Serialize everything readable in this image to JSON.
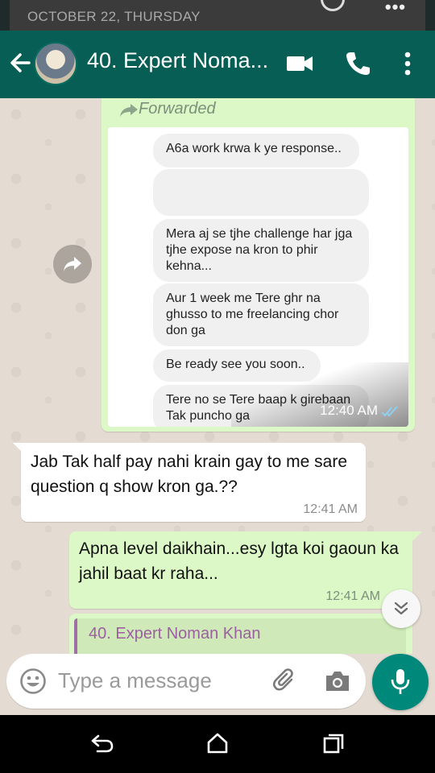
{
  "notification": {
    "date_text": "OCTOBER 22, THURSDAY"
  },
  "header": {
    "contact_name": "40. Expert Noma..."
  },
  "forwarded_message": {
    "label": "Forwarded",
    "time": "12:40 AM",
    "screenshot_bubbles": [
      "A6a work krwa k ye response..",
      "",
      "Mera aj se tjhe challenge har jga tjhe expose na kron to phir kehna...",
      "Aur 1 week me Tere ghr na ghusso to me freelancing chor don ga",
      "Be ready see you soon..",
      "Tere no se Tere baap k girebaan Tak puncho ga"
    ]
  },
  "messages": [
    {
      "direction": "incoming",
      "text": "Jab Tak half pay nahi krain gay to me sare question q show kron ga.??",
      "time": "12:41 AM"
    },
    {
      "direction": "outgoing",
      "text": "Apna level daikhain...esy lgta koi gaoun ka jahil baat kr raha...",
      "time": "12:41 AM"
    }
  ],
  "reply_quote": {
    "name": "40. Expert Noman Khan"
  },
  "composer": {
    "placeholder": "Type a message"
  },
  "colors": {
    "header": "#075e54",
    "outgoing_bubble": "#dcf8c6",
    "incoming_bubble": "#ffffff",
    "mic_button": "#00897b",
    "ticks": "#4fc3f7",
    "quote_bar": "#9f6fa5"
  }
}
